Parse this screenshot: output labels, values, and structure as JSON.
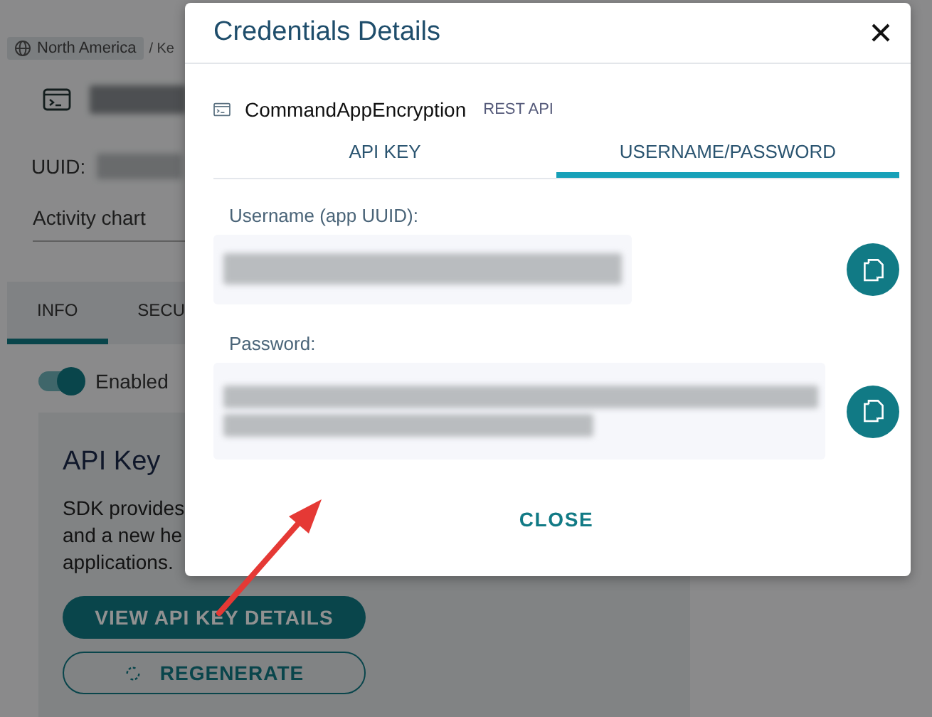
{
  "breadcrumb": [
    {
      "label": "North America",
      "kind": "chip"
    },
    {
      "label": "/ Ke",
      "kind": "text"
    }
  ],
  "uuid_label": "UUID:",
  "activity_chart": "Activity chart",
  "tabs": [
    {
      "label": "INFO",
      "selected": true
    },
    {
      "label": "SECU",
      "selected": false
    }
  ],
  "toggle": {
    "label": "Enabled",
    "on": true
  },
  "card": {
    "title": "API Key",
    "lines": [
      "SDK provides",
      "and a new he",
      "applications."
    ]
  },
  "buttons": [
    {
      "label": "VIEW API KEY DETAILS",
      "kind": "primary"
    },
    {
      "label": "REGENERATE",
      "kind": "outline"
    }
  ],
  "dialog": {
    "title": "Credentials Details",
    "app_name": "CommandAppEncryption",
    "app_type": "REST API",
    "tabs": [
      {
        "label": "API KEY",
        "selected": false
      },
      {
        "label": "USERNAME/PASSWORD",
        "selected": true
      }
    ],
    "fields": [
      {
        "label": "Username (app UUID):",
        "kind": "single"
      },
      {
        "label": "Password:",
        "kind": "multi"
      }
    ],
    "close": "CLOSE"
  }
}
